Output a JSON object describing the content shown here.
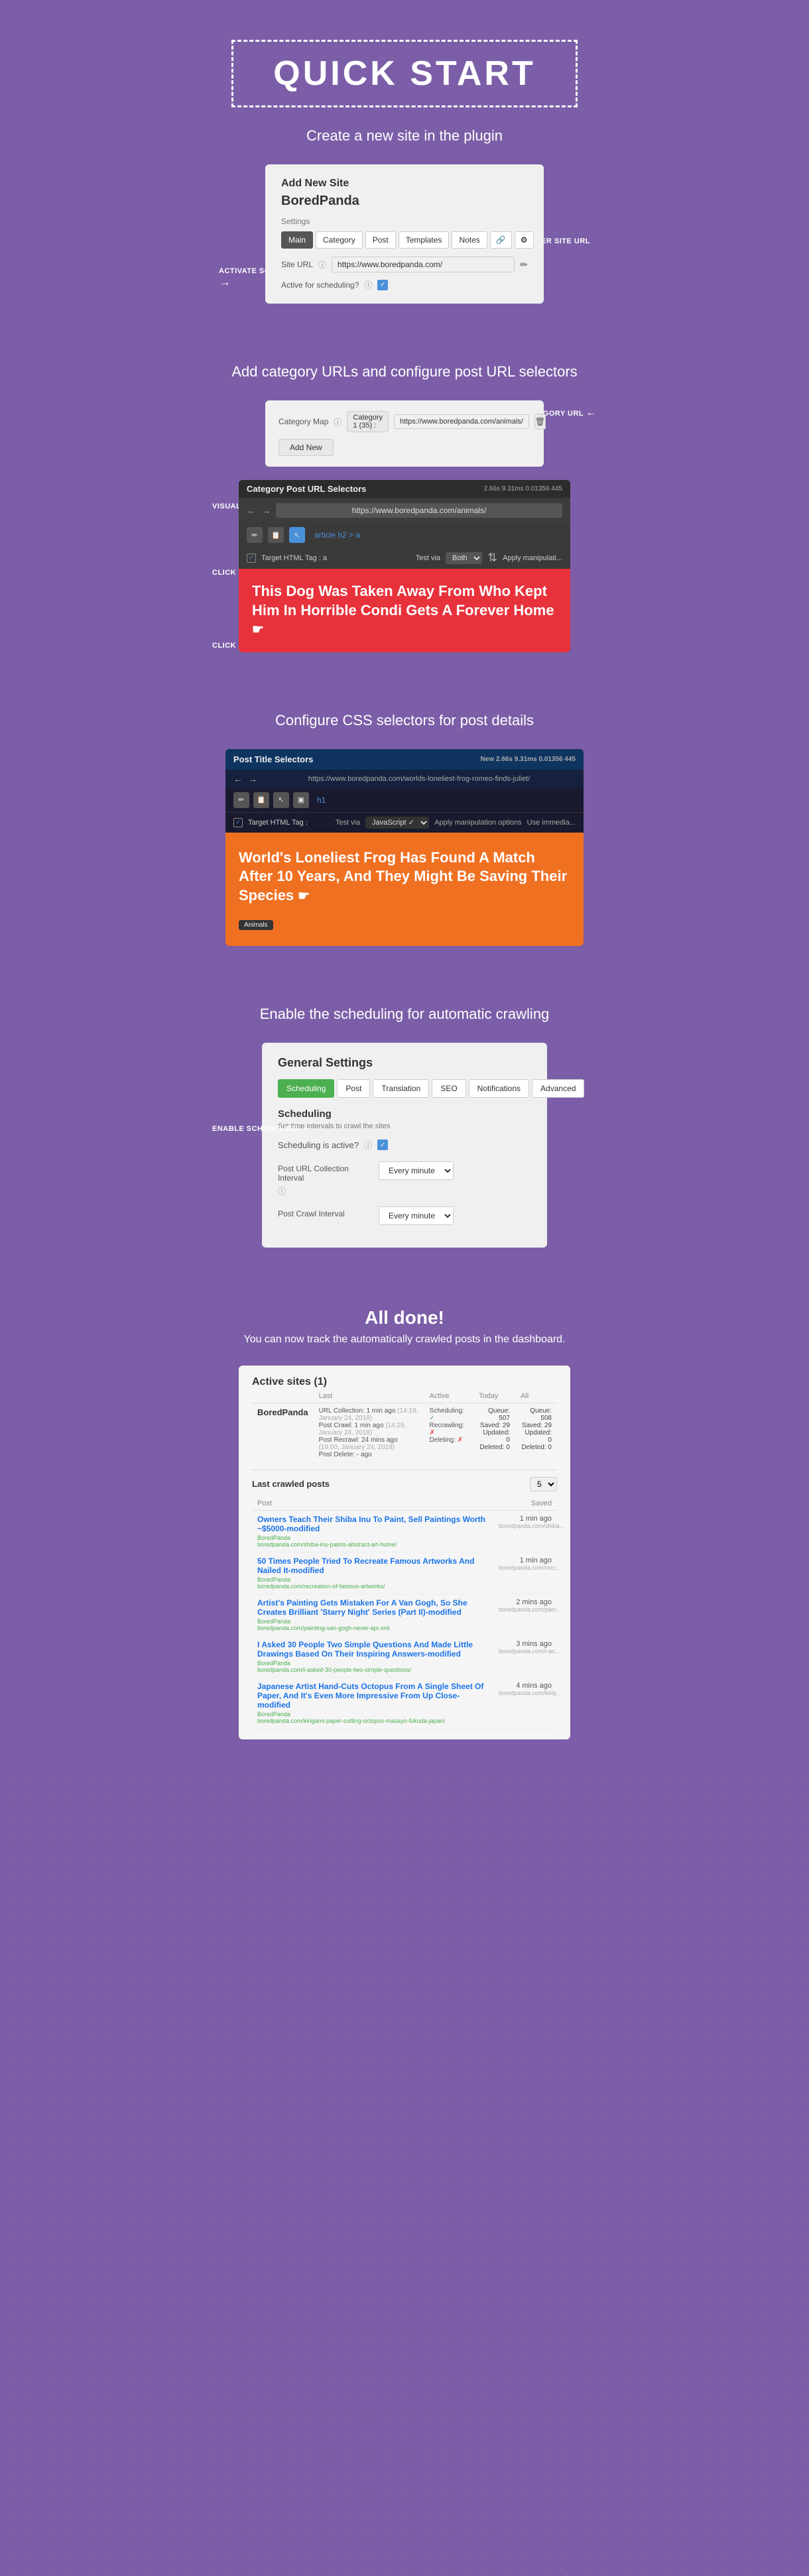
{
  "quickstart": {
    "title": "QUICK START",
    "description": "Create a new site in the plugin",
    "card": {
      "heading": "Add New Site",
      "site_name": "BoredPanda",
      "settings_label": "Settings",
      "tabs": [
        "Main",
        "Category",
        "Post",
        "Templates",
        "Notes"
      ],
      "site_url_label": "Site URL",
      "site_url_value": "https://www.boredpanda.com/",
      "scheduling_label": "Active for scheduling?",
      "checkbox_checked": "✓"
    },
    "annotation_enter": "ENTER SITE URL",
    "annotation_activate": "ACTIVATE\nSCHEDULING"
  },
  "section2": {
    "description": "Add category URLs and configure post URL selectors",
    "category_card": {
      "label": "Category Map",
      "badge": "Category 1 (35) :",
      "url": "https://www.boredpanda.com/animals/",
      "add_new": "Add New"
    },
    "annotation_target": "TARGET\nCATEGORY URL",
    "annotation_visual": "VISUAL CSS\nSELECTOR FINDER",
    "annotation_click_use": "CLICK TO USE\nTHE SELECTOR",
    "annotation_click_find": "CLICK ELEMENT TO\nFIND A CSS SELECTOR",
    "browser": {
      "title": "Category Post URL Selectors",
      "stats": "2.66s  9.31ms  0.01356  445",
      "url": "https://www.boredpanda.com/animals/",
      "selector_text": "article h2 > a",
      "target_html_label": "Target HTML Tag : a",
      "test_via_label": "Test via",
      "test_via_value": "Both",
      "apply_label": "Apply manipulati...",
      "headline": "This Dog Was Taken Away From Who Kept Him In Horrible Condi Gets A Forever Home"
    }
  },
  "section3": {
    "description": "Configure CSS selectors for post details",
    "browser": {
      "title": "Post Title Selectors",
      "stats": "New  2.66s  9.31ms  0.01356  445",
      "url": "https://www.boredpanda.com/worlds-loneliest-frog-romeo-finds-juliet/",
      "selector": "h1",
      "target_html_label": "Target HTML Tag :",
      "test_via_label": "Test via",
      "test_via_value": "JavaScript ✓",
      "apply_label": "Apply manipulation options",
      "use_immed_label": "Use immedia...",
      "headline": "World's Loneliest Frog Has Found A Match After 10 Years, And They Might Be Saving Their Species",
      "tag": "Animals"
    }
  },
  "section4": {
    "description": "Enable the scheduling for automatic crawling",
    "card": {
      "title": "General Settings",
      "tabs": [
        "Scheduling",
        "Post",
        "Translation",
        "SEO",
        "Notifications",
        "Advanced"
      ],
      "active_tab": "Scheduling",
      "scheduling_title": "Scheduling",
      "scheduling_desc": "Set time intervals to crawl the sites",
      "active_label": "Scheduling is active?",
      "checkbox": "✓",
      "field1_label": "Post URL Collection\nInterval",
      "field1_value": "Every minute",
      "field2_label": "Post Crawl Interval",
      "field2_value": "Every minute"
    },
    "annotation_enable": "ENABLE\nSCHEDULING"
  },
  "section5": {
    "title": "All done!",
    "desc": "You can now track the automatically crawled posts in the dashboard.",
    "dashboard": {
      "active_sites_label": "Active sites (1)",
      "columns": [
        "",
        "Last",
        "Active",
        "Today",
        "All"
      ],
      "site_name": "BoredPanda",
      "last_items": [
        "URL Collection: 1 min ago",
        "Post Crawl: 1 min ago",
        "Post Recrawl: 24 mins ago",
        "Post Delete: - ago"
      ],
      "last_timestamps": [
        "(14:19, January 24, 2018)",
        "(14:19, January 24, 2018)",
        "(19:00, January 24, 2018)",
        ""
      ],
      "active_items": [
        "Scheduling:",
        "Recrawling:",
        "Deleting:"
      ],
      "active_icons": [
        "✓",
        "✗",
        "✗"
      ],
      "today_items": [
        "Queue: 507",
        "Saved: 29",
        "Updated: 0",
        "Deleted: 0"
      ],
      "all_items": [
        "Queue: 508",
        "Saved: 29",
        "Updated: 0",
        "Deleted: 0"
      ],
      "last_crawled_title": "Last crawled posts",
      "page_select_value": "5",
      "posts_col": "Post",
      "saved_col": "Saved",
      "posts": [
        {
          "title": "Owners Teach Their Shiba Inu To Paint, Sell Paintings Worth ~$5000-modified",
          "site": "BoredPanda",
          "url": "boredpanda.com/shiba-inu-paints-abstract-art-hume/",
          "saved": "1 min ago"
        },
        {
          "title": "50 Times People Tried To Recreate Famous Artworks And Nailed It-modified",
          "site": "BoredPanda",
          "url": "boredpanda.com/recreation-of-famous-artworks/",
          "saved": "1 min ago"
        },
        {
          "title": "Artist's Painting Gets Mistaken For A Van Gogh, So She Creates Brilliant 'Starry Night' Series (Part II)-modified",
          "site": "BoredPanda",
          "url": "boredpanda.com/painting-van-gogh-never-apr.xml",
          "saved": "2 mins ago"
        },
        {
          "title": "I Asked 30 People Two Simple Questions And Made Little Drawings Based On Their Inspiring Answers-modified",
          "site": "BoredPanda",
          "url": "boredpanda.com/i-asked-30-people-two-simple-questions/",
          "saved": "3 mins ago"
        },
        {
          "title": "Japanese Artist Hand-Cuts Octopus From A Single Sheet Of Paper, And It's Even More Impressive From Up Close-modified",
          "site": "BoredPanda",
          "url": "boredpanda.com/kirigami-paper-cutting-octopus-masayo-fukuda-japan/",
          "saved": "4 mins ago"
        }
      ]
    }
  }
}
